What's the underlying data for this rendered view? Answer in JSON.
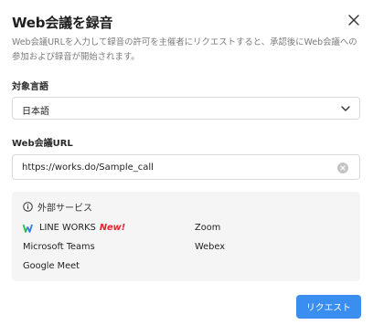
{
  "dialog": {
    "title": "Web会議を録音",
    "description": "Web会議URLを入力して録音の許可を主催者にリクエストすると、承認後にWeb会議への参加および録音が開始されます。"
  },
  "language": {
    "label": "対象言語",
    "selected": "日本語"
  },
  "url": {
    "label": "Web会議URL",
    "value": "https://works.do/Sample_call"
  },
  "services": {
    "heading": "外部サービス",
    "items": [
      {
        "name": "LINE WORKS",
        "badge": "New!"
      },
      {
        "name": "Zoom"
      },
      {
        "name": "Microsoft Teams"
      },
      {
        "name": "Webex"
      },
      {
        "name": "Google Meet"
      }
    ]
  },
  "actions": {
    "request_label": "リクエスト"
  },
  "colors": {
    "accent": "#3a8ef0",
    "new_badge": "#e8232a"
  },
  "icons": [
    "close-icon",
    "chevron-down-icon",
    "clear-icon",
    "info-icon",
    "line-works-logo-icon"
  ]
}
